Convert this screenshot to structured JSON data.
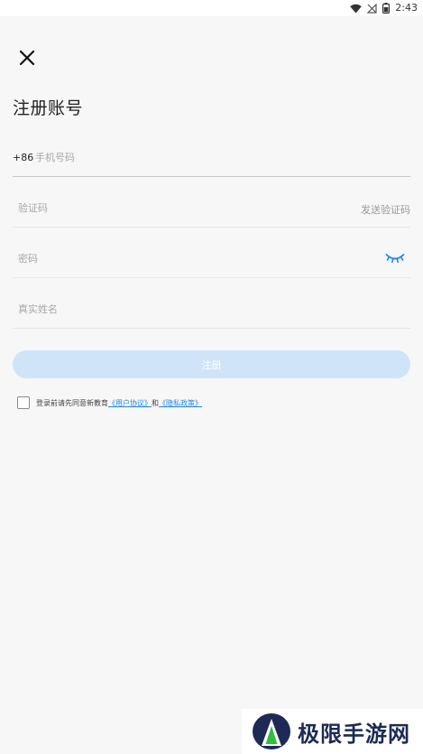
{
  "status_bar": {
    "time": "2:43",
    "icons": [
      "wifi-icon",
      "no-signal-icon",
      "battery-icon"
    ]
  },
  "close_icon": "close-icon",
  "title": "注册账号",
  "form": {
    "phone": {
      "prefix": "+86",
      "placeholder": "手机号码",
      "value": ""
    },
    "code": {
      "placeholder": "验证码",
      "value": "",
      "send_label": "发送验证码"
    },
    "password": {
      "placeholder": "密码",
      "value": "",
      "toggle_icon": "eye-closed-icon"
    },
    "name": {
      "placeholder": "真实姓名",
      "value": ""
    }
  },
  "register_button": "注册",
  "agreement": {
    "checked": false,
    "prefix": "登录前请先同意新教育",
    "user_agreement": "《用户协议》",
    "and": "和",
    "privacy_policy": "《隐私政策》"
  },
  "watermark": {
    "text": "极限手游网"
  },
  "colors": {
    "accent": "#1e88e5",
    "button_disabled": "#cfe4f8",
    "background": "#f7f7f8"
  }
}
